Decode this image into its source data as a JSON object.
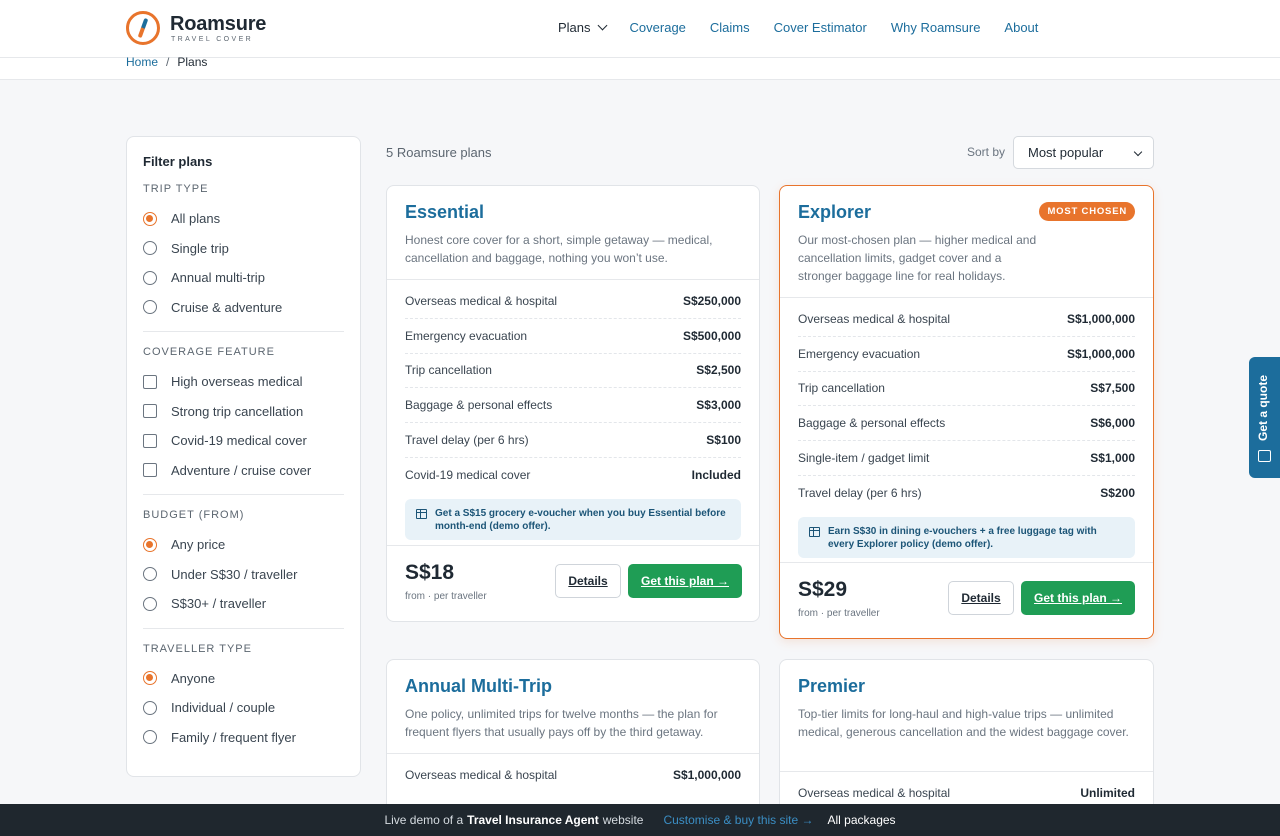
{
  "brand": {
    "name": "Roamsure",
    "tagline": "TRAVEL COVER"
  },
  "nav": {
    "items": [
      "Plans",
      "Coverage",
      "Claims",
      "Cover Estimator",
      "Why Roamsure",
      "About"
    ]
  },
  "breadcrumb": {
    "home": "Home",
    "sep": "/",
    "current": "Plans"
  },
  "sidebar": {
    "title": "Filter plans",
    "groups": [
      {
        "title": "TRIP TYPE",
        "type": "radio",
        "options": [
          "All plans",
          "Single trip",
          "Annual multi-trip",
          "Cruise & adventure"
        ],
        "selected": "All plans"
      },
      {
        "title": "COVERAGE FEATURE",
        "type": "checkbox",
        "options": [
          "High overseas medical",
          "Strong trip cancellation",
          "Covid-19 medical cover",
          "Adventure / cruise cover"
        ]
      },
      {
        "title": "BUDGET (FROM)",
        "type": "radio",
        "options": [
          "Any price",
          "Under S$30 / traveller",
          "S$30+ / traveller"
        ],
        "selected": "Any price"
      },
      {
        "title": "TRAVELLER TYPE",
        "type": "radio",
        "options": [
          "Anyone",
          "Individual / couple",
          "Family / frequent flyer"
        ],
        "selected": "Anyone"
      }
    ]
  },
  "results": {
    "count_label": "5 Roamsure plans",
    "sort_label": "Sort by",
    "sort_value": "Most popular"
  },
  "plans": [
    {
      "name": "Essential",
      "desc": "Honest core cover for a short, simple getaway — medical, cancellation and baggage, nothing you won’t use.",
      "rows": [
        [
          "Overseas medical & hospital",
          "S$250,000"
        ],
        [
          "Emergency evacuation",
          "S$500,000"
        ],
        [
          "Trip cancellation",
          "S$2,500"
        ],
        [
          "Baggage & personal effects",
          "S$3,000"
        ],
        [
          "Travel delay (per 6 hrs)",
          "S$100"
        ],
        [
          "Covid-19 medical cover",
          "Included"
        ]
      ],
      "offer": "Get a S$15 grocery e-voucher when you buy Essential before month-end (demo offer).",
      "price": "S$18",
      "per": "from · per traveller",
      "details": "Details",
      "cta": "Get this plan →"
    },
    {
      "name": "Explorer",
      "badge": "MOST CHOSEN",
      "desc": "Our most-chosen plan — higher medical and cancellation limits, gadget cover and a stronger baggage line for real holidays.",
      "rows": [
        [
          "Overseas medical & hospital",
          "S$1,000,000"
        ],
        [
          "Emergency evacuation",
          "S$1,000,000"
        ],
        [
          "Trip cancellation",
          "S$7,500"
        ],
        [
          "Baggage & personal effects",
          "S$6,000"
        ],
        [
          "Single-item / gadget limit",
          "S$1,000"
        ],
        [
          "Travel delay (per 6 hrs)",
          "S$200"
        ]
      ],
      "offer": "Earn S$30 in dining e-vouchers + a free luggage tag with every Explorer policy (demo offer).",
      "price": "S$29",
      "per": "from · per traveller",
      "details": "Details",
      "cta": "Get this plan →"
    },
    {
      "name": "Annual Multi-Trip",
      "desc": "One policy, unlimited trips for twelve months — the plan for frequent flyers that usually pays off by the third getaway.",
      "rows": [
        [
          "Overseas medical & hospital",
          "S$1,000,000"
        ]
      ]
    },
    {
      "name": "Premier",
      "desc": "Top-tier limits for long-haul and high-value trips — unlimited medical, generous cancellation and the widest baggage cover.",
      "rows": [
        [
          "Overseas medical & hospital",
          "Unlimited"
        ]
      ]
    }
  ],
  "quote_tab": "Get a quote",
  "bottom_bar": {
    "prefix": "Live demo of a",
    "site": "Travel Insurance Agent",
    "suffix": "website",
    "link": "Customise & buy this site →",
    "all": "All packages"
  },
  "colors": {
    "accent": "#e8742c",
    "brand_blue": "#1c6d9c",
    "cta_green": "#1f9d55"
  }
}
